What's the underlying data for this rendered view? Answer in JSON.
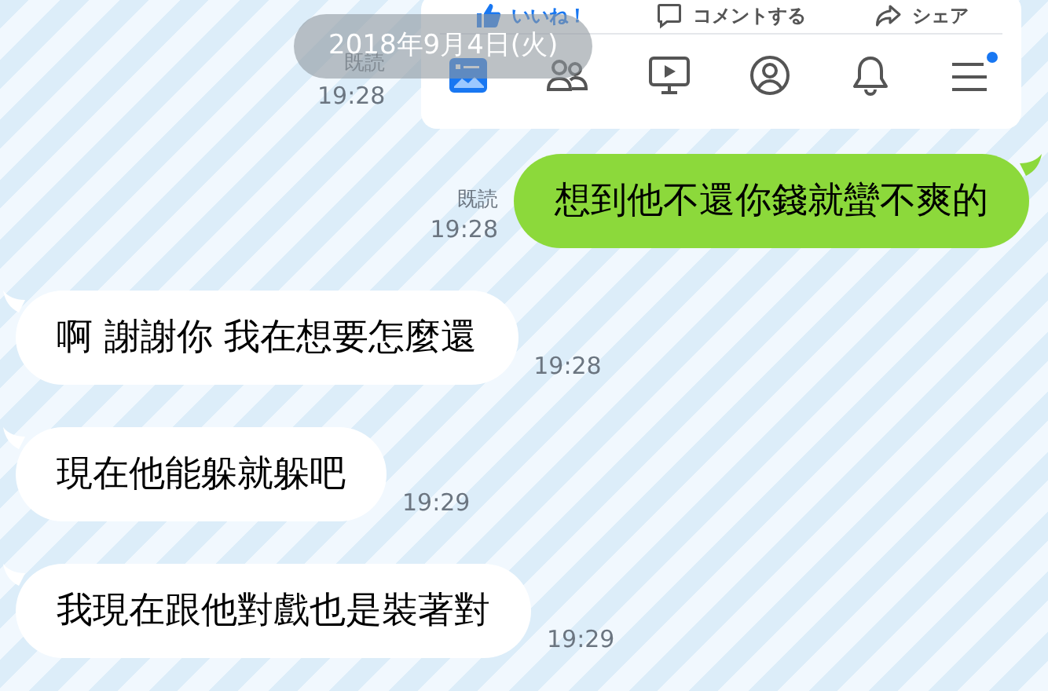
{
  "embedded_post": {
    "actions": [
      {
        "kind": "like",
        "label": "いいね！",
        "selected": true
      },
      {
        "kind": "comment",
        "label": "コメントする",
        "selected": false
      },
      {
        "kind": "share",
        "label": "シェア",
        "selected": false
      }
    ],
    "nav": [
      {
        "kind": "feed",
        "selected": true,
        "notification": false
      },
      {
        "kind": "friends",
        "selected": false,
        "notification": false
      },
      {
        "kind": "video",
        "selected": false,
        "notification": false
      },
      {
        "kind": "profile",
        "selected": false,
        "notification": false
      },
      {
        "kind": "bell",
        "selected": false,
        "notification": false
      },
      {
        "kind": "menu",
        "selected": false,
        "notification": true
      }
    ]
  },
  "card_status": {
    "read": "既読",
    "time": "19:28"
  },
  "date_pill": "2018年9月4日(火)",
  "messages": [
    {
      "kind": "sent",
      "text": "想到他不還你錢就蠻不爽的",
      "read": "既読",
      "time": "19:28"
    },
    {
      "kind": "received",
      "text": "啊 謝謝你 我在想要怎麼還",
      "time": "19:28"
    },
    {
      "kind": "received",
      "text": "現在他能躲就躲吧",
      "time": "19:29"
    },
    {
      "kind": "received",
      "text": "我現在跟他對戲也是裝著對",
      "time": "19:29"
    }
  ]
}
